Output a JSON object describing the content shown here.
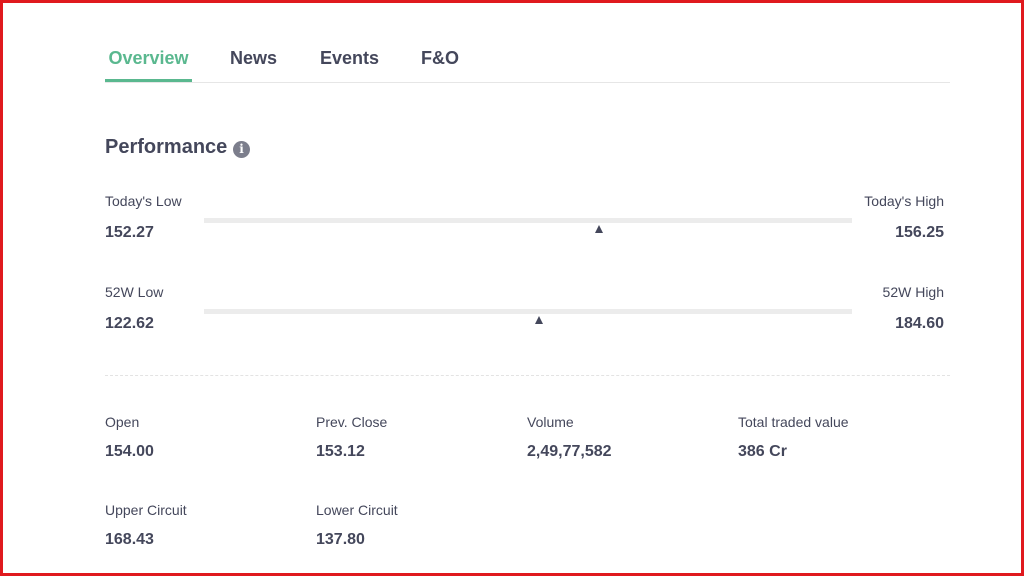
{
  "tabs": [
    {
      "label": "Overview",
      "active": true
    },
    {
      "label": "News",
      "active": false
    },
    {
      "label": "Events",
      "active": false
    },
    {
      "label": "F&O",
      "active": false
    }
  ],
  "performance": {
    "title": "Performance",
    "info_icon": "info-icon",
    "today": {
      "low_label": "Today's Low",
      "low": "152.27",
      "high_label": "Today's High",
      "high": "156.25",
      "marker_fraction": 0.609
    },
    "week52": {
      "low_label": "52W Low",
      "low": "122.62",
      "high_label": "52W High",
      "high": "184.60",
      "marker_fraction": 0.517
    }
  },
  "stats": [
    {
      "label": "Open",
      "value": "154.00"
    },
    {
      "label": "Prev. Close",
      "value": "153.12"
    },
    {
      "label": "Volume",
      "value": "2,49,77,582"
    },
    {
      "label": "Total traded value",
      "value": "386 Cr"
    },
    {
      "label": "Upper Circuit",
      "value": "168.43"
    },
    {
      "label": "Lower Circuit",
      "value": "137.80"
    }
  ],
  "colors": {
    "accent": "#5ab88f",
    "text": "#44475b",
    "frame": "#e0191e"
  }
}
